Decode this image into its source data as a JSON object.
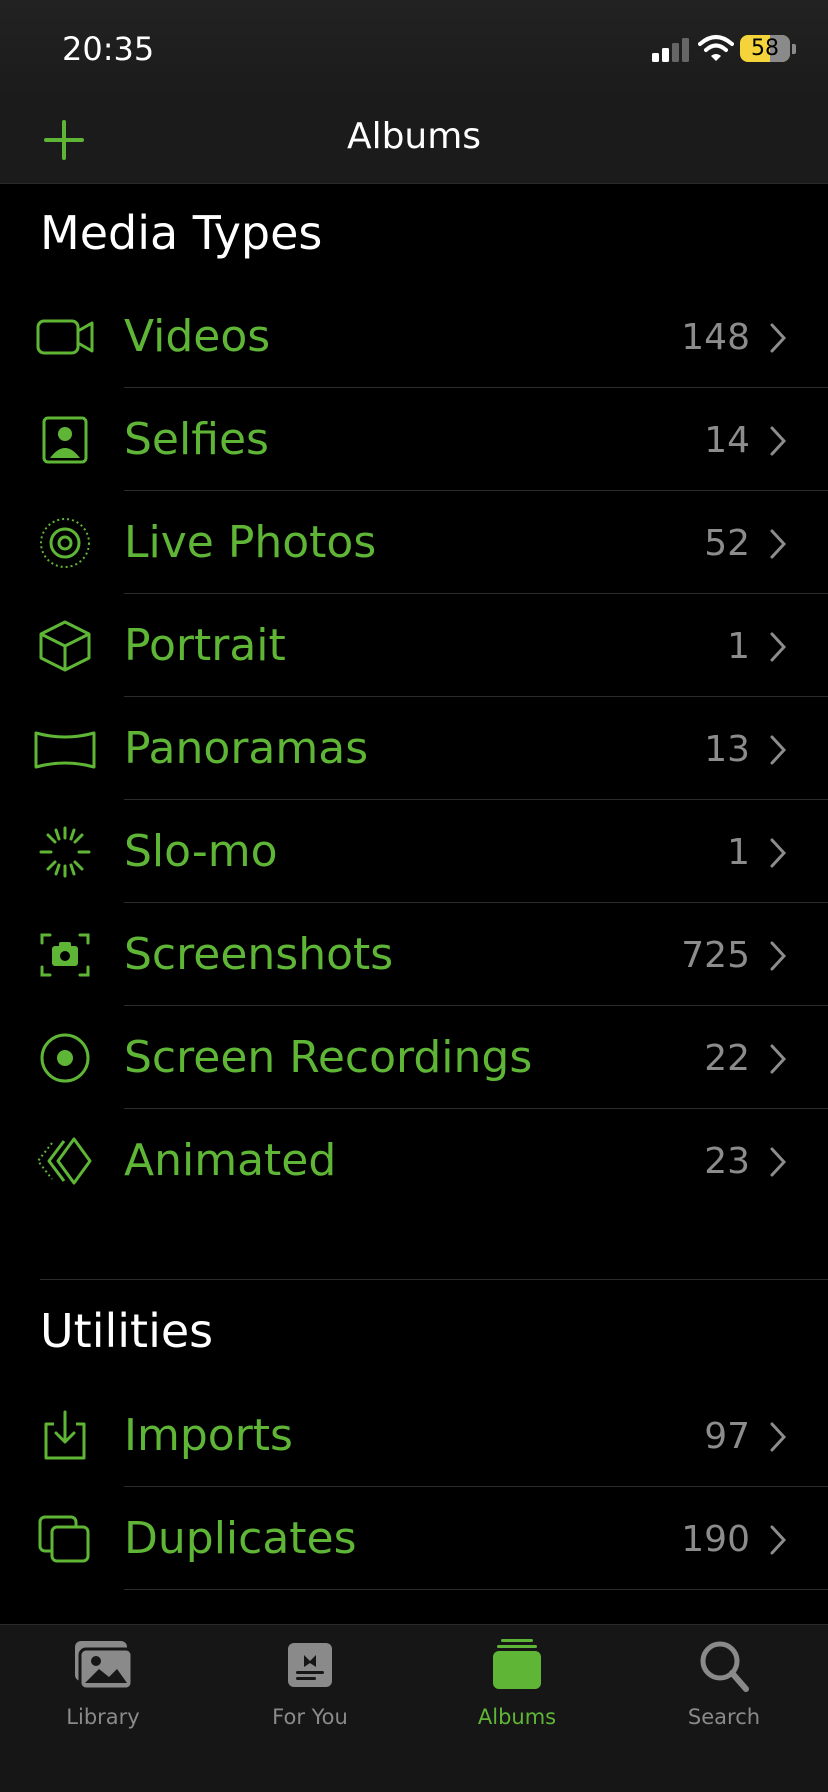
{
  "status_bar": {
    "time": "20:35",
    "battery": "58"
  },
  "nav": {
    "title": "Albums",
    "add_icon": "plus-icon"
  },
  "sections": {
    "media_types": {
      "title": "Media Types",
      "items": [
        {
          "label": "Videos",
          "count": "148",
          "icon": "video-camera-icon"
        },
        {
          "label": "Selfies",
          "count": "14",
          "icon": "selfie-portrait-icon"
        },
        {
          "label": "Live Photos",
          "count": "52",
          "icon": "live-photo-icon"
        },
        {
          "label": "Portrait",
          "count": "1",
          "icon": "cube-icon"
        },
        {
          "label": "Panoramas",
          "count": "13",
          "icon": "panorama-icon"
        },
        {
          "label": "Slo-mo",
          "count": "1",
          "icon": "slomo-icon"
        },
        {
          "label": "Screenshots",
          "count": "725",
          "icon": "screenshot-icon"
        },
        {
          "label": "Screen Recordings",
          "count": "22",
          "icon": "screen-recording-icon"
        },
        {
          "label": "Animated",
          "count": "23",
          "icon": "animated-icon"
        }
      ]
    },
    "utilities": {
      "title": "Utilities",
      "items": [
        {
          "label": "Imports",
          "count": "97",
          "icon": "import-icon"
        },
        {
          "label": "Duplicates",
          "count": "190",
          "icon": "duplicates-icon"
        }
      ]
    }
  },
  "tabs": [
    {
      "label": "Library",
      "icon": "photo-library-icon",
      "active": false
    },
    {
      "label": "For You",
      "icon": "for-you-icon",
      "active": false
    },
    {
      "label": "Albums",
      "icon": "albums-icon",
      "active": true
    },
    {
      "label": "Search",
      "icon": "search-icon",
      "active": false
    }
  ],
  "colors": {
    "accent": "#5fb636",
    "background": "#000000",
    "count": "#8c8c8c",
    "battery": "#f5d33b"
  }
}
